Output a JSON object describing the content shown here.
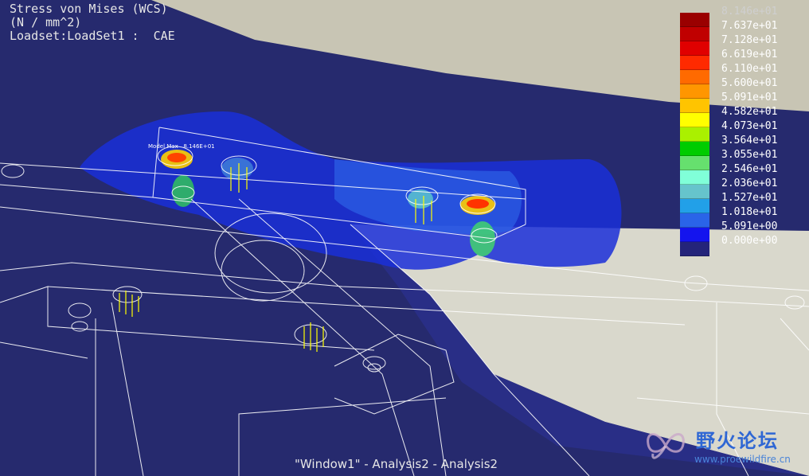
{
  "header": {
    "line1": "Stress von Mises (WCS)",
    "line2": "(N / mm^2)",
    "line3": "Loadset:LoadSet1 :  CAE"
  },
  "annotation": {
    "model_max": "Model Max   8.146E+01"
  },
  "legend": {
    "top_value": "8.146e+01",
    "rows": [
      {
        "color": "#c00000",
        "label": "7.637e+01"
      },
      {
        "color": "#e00000",
        "label": "7.128e+01"
      },
      {
        "color": "#ff2a00",
        "label": "6.619e+01"
      },
      {
        "color": "#ff6a00",
        "label": "6.110e+01"
      },
      {
        "color": "#ff9600",
        "label": "5.600e+01"
      },
      {
        "color": "#ffc400",
        "label": "5.091e+01"
      },
      {
        "color": "#ffff00",
        "label": "4.582e+01"
      },
      {
        "color": "#aaf000",
        "label": "4.073e+01"
      },
      {
        "color": "#00cc00",
        "label": "3.564e+01"
      },
      {
        "color": "#66e06e",
        "label": "3.055e+01"
      },
      {
        "color": "#80ffd8",
        "label": "2.546e+01"
      },
      {
        "color": "#66c4cc",
        "label": "2.036e+01"
      },
      {
        "color": "#22a0e8",
        "label": "1.527e+01"
      },
      {
        "color": "#2a64e8",
        "label": "1.018e+01"
      },
      {
        "color": "#1414ee",
        "label": "5.091e+00"
      },
      {
        "color": "#24247a",
        "label": "0.000e+00"
      }
    ]
  },
  "footer": {
    "window_title": "\"Window1\" - Analysis2 - Analysis2"
  },
  "watermark": {
    "cn": "野火论坛",
    "url": "www.proewildfire.cn"
  }
}
